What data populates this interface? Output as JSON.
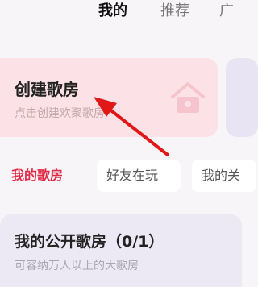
{
  "top_tabs": [
    {
      "label": "我的"
    },
    {
      "label": "推荐"
    },
    {
      "label": "广"
    }
  ],
  "create_room": {
    "title": "创建歌房",
    "subtitle": "点击创建欢聚歌房"
  },
  "filter_chips": [
    {
      "label": "我的歌房"
    },
    {
      "label": "好友在玩"
    },
    {
      "label": "我的关"
    }
  ],
  "public_rooms": {
    "title": "我的公开歌房（0/1）",
    "subtitle": "可容纳万人以上的大歌房"
  },
  "colors": {
    "accent": "#e12a46",
    "arrow": "#e01818",
    "create_card_bg": "#fce2e6",
    "public_card_bg": "#ece8f4"
  },
  "icons": {
    "create_card_art": "house-icon",
    "annotation": "arrow-icon"
  }
}
